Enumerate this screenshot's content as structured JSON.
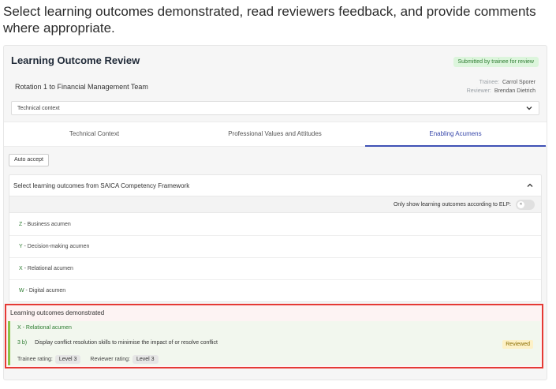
{
  "instruction": "Select learning outcomes demonstrated, read reviewers feedback, and provide comments where appropriate.",
  "review": {
    "title": "Learning Outcome Review",
    "status": "Submitted by trainee for review",
    "rotation": "Rotation 1 to Financial Management Team",
    "trainee_label": "Trainee:",
    "trainee_name": "Carrol Sporer",
    "reviewer_label": "Reviewer:",
    "reviewer_name": "Brendan Dietrich",
    "context_value": "Technical context"
  },
  "tabs": [
    {
      "label": "Technical Context",
      "active": false
    },
    {
      "label": "Professional Values and Attitudes",
      "active": false
    },
    {
      "label": "Enabling Acumens",
      "active": true
    }
  ],
  "auto_accept_label": "Auto accept",
  "outcomes": {
    "heading": "Select learning outcomes from SAICA Competency Framework",
    "filter_label": "Only show learning outcomes according to ELP:",
    "toggle_text": "✕",
    "items": [
      {
        "code": "Z",
        "name": "Business acumen"
      },
      {
        "code": "Y",
        "name": "Decision-making acumen"
      },
      {
        "code": "X",
        "name": "Relational acumen"
      },
      {
        "code": "W",
        "name": "Digital acumen"
      }
    ]
  },
  "demonstrated": {
    "heading": "Learning outcomes demonstrated",
    "acumen": "X - Relational acumen",
    "ref": "3 b)",
    "description": "Display conflict resolution skills to minimise the impact of or resolve conflict",
    "badge": "Reviewed",
    "trainee_rating_label": "Trainee rating:",
    "trainee_rating": "Level 3",
    "reviewer_rating_label": "Reviewer rating:",
    "reviewer_rating": "Level 3"
  },
  "colors": {
    "accent": "#3f51b5",
    "highlight_border": "#e53935",
    "success": "#2e7d32"
  },
  "icons": {
    "context_dropdown": "chevron-down-icon",
    "collapse": "chevron-up-icon"
  }
}
